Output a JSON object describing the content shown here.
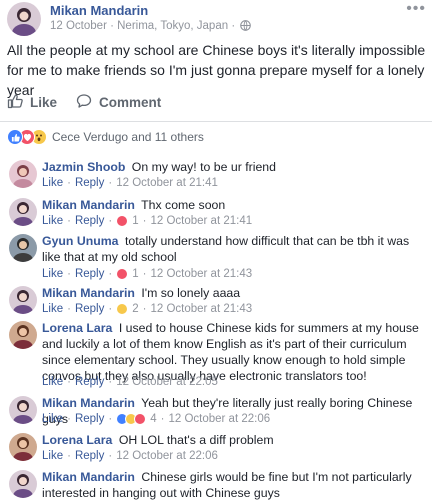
{
  "post": {
    "author": "Mikan Mandarin",
    "meta": "12 October · Nerima, Tokyo, Japan ·",
    "text": "All the people at my school are Chinese boys it's literally impossible for me to make friends so I'm just gonna prepare myself for a lonely year",
    "like_label": "Like",
    "comment_label": "Comment",
    "reactions_text": "Cece Verdugo and 11 others"
  },
  "colors": {
    "link": "#385898",
    "meta": "#90949c",
    "like_blue": "#4080ff",
    "love_red": "#f25268",
    "wow_yellow": "#f7c84b"
  },
  "comments": [
    {
      "name": "Jazmin Shoob",
      "text": "On my way! to be ur friend",
      "like": "Like",
      "reply": "Reply",
      "time": "12 October at 21:41",
      "reaction_count": ""
    },
    {
      "name": "Mikan Mandarin",
      "text": "Thx come soon",
      "like": "Like",
      "reply": "Reply",
      "time": "12 October at 21:41",
      "reaction_count": "1"
    },
    {
      "name": "Gyun Unuma",
      "text": "totally understand how difficult that can be tbh it was like that at my old school",
      "like": "Like",
      "reply": "Reply",
      "time": "12 October at 21:43",
      "reaction_count": "1"
    },
    {
      "name": "Mikan Mandarin",
      "text": "I'm so lonely aaaa",
      "like": "Like",
      "reply": "Reply",
      "time": "12 October at 21:43",
      "reaction_count": "2"
    },
    {
      "name": "Lorena Lara",
      "text": "I used to house Chinese kids for summers at my house and luckily a lot of them know English as it's part of their curriculum since elementary school. They usually know enough to hold simple convos but they also usually have electronic translators too!",
      "like": "Like",
      "reply": "Reply",
      "time": "12 October at 22:05",
      "reaction_count": ""
    },
    {
      "name": "Mikan Mandarin",
      "text": "Yeah but they're literally just really boring Chinese guys",
      "like": "Like",
      "reply": "Reply",
      "time": "12 October at 22:06",
      "reaction_count": "4"
    },
    {
      "name": "Lorena Lara",
      "text": "OH LOL that's a diff problem",
      "like": "Like",
      "reply": "Reply",
      "time": "12 October at 22:06",
      "reaction_count": ""
    },
    {
      "name": "Mikan Mandarin",
      "text": "Chinese girls would be fine but I'm not particularly interested in hanging out with Chinese guys",
      "like": "",
      "reply": "",
      "time": "",
      "reaction_count": ""
    }
  ]
}
